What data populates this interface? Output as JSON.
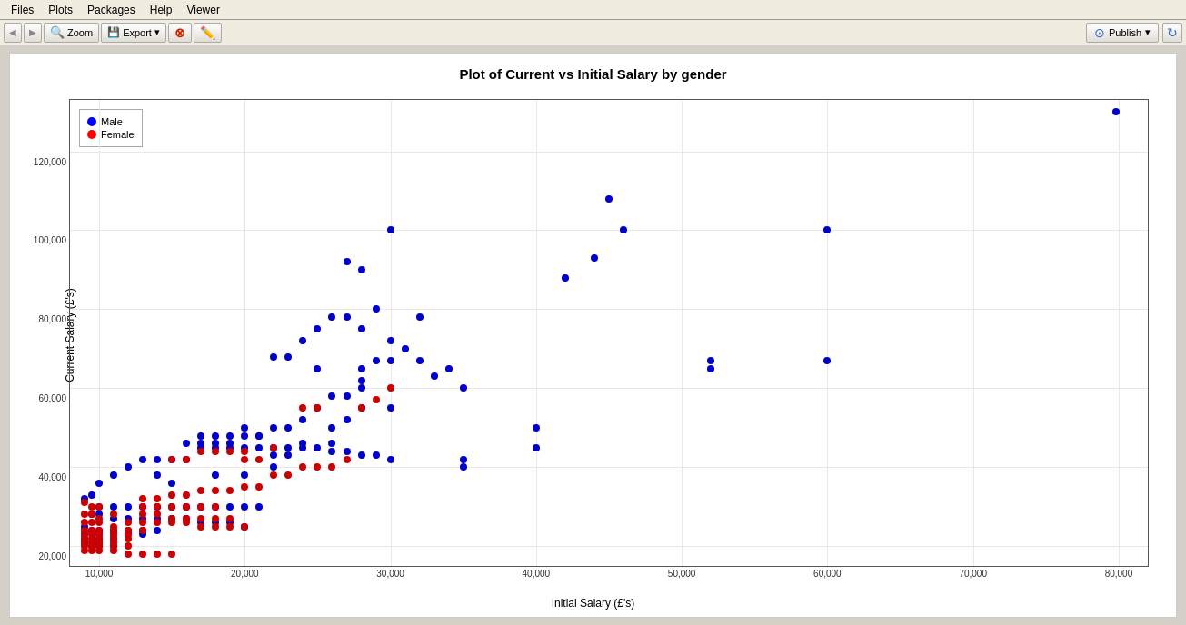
{
  "menubar": {
    "items": [
      "Files",
      "Plots",
      "Packages",
      "Help",
      "Viewer"
    ]
  },
  "toolbar": {
    "back_label": "◀",
    "forward_label": "▶",
    "zoom_label": "Zoom",
    "export_label": "Export",
    "export_arrow": "▾",
    "clear_label": "✕",
    "brush_icon": "✏",
    "publish_label": "Publish",
    "publish_arrow": "▾",
    "refresh_icon": "↻"
  },
  "plot": {
    "title": "Plot of Current vs Initial Salary by gender",
    "x_axis_label": "Initial Salary (£'s)",
    "y_axis_label": "Current Salary (£'s)",
    "x_ticks": [
      "10000",
      "20000",
      "30000",
      "40000",
      "50000",
      "60000",
      "70000",
      "80000"
    ],
    "y_ticks": [
      "20000",
      "40000",
      "60000",
      "80000",
      "100000",
      "120000"
    ],
    "legend": [
      {
        "label": "Male",
        "color": "#0000ff"
      },
      {
        "label": "Female",
        "color": "#ff0000"
      }
    ],
    "blue_dots": [
      [
        79800,
        130000
      ],
      [
        45000,
        108000
      ],
      [
        46000,
        100000
      ],
      [
        42000,
        88000
      ],
      [
        44000,
        93000
      ],
      [
        30000,
        100000
      ],
      [
        27000,
        92000
      ],
      [
        28000,
        90000
      ],
      [
        32000,
        78000
      ],
      [
        29000,
        67000
      ],
      [
        27000,
        78000
      ],
      [
        26000,
        78000
      ],
      [
        28000,
        75000
      ],
      [
        31000,
        70000
      ],
      [
        30000,
        72000
      ],
      [
        29000,
        80000
      ],
      [
        25000,
        75000
      ],
      [
        24000,
        72000
      ],
      [
        23000,
        68000
      ],
      [
        22000,
        68000
      ],
      [
        30000,
        67000
      ],
      [
        32000,
        67000
      ],
      [
        28000,
        65000
      ],
      [
        34000,
        65000
      ],
      [
        33000,
        63000
      ],
      [
        35000,
        60000
      ],
      [
        30000,
        55000
      ],
      [
        28000,
        60000
      ],
      [
        28000,
        55000
      ],
      [
        27000,
        52000
      ],
      [
        26000,
        50000
      ],
      [
        25000,
        55000
      ],
      [
        24000,
        52000
      ],
      [
        23000,
        50000
      ],
      [
        22000,
        50000
      ],
      [
        21000,
        48000
      ],
      [
        20000,
        50000
      ],
      [
        19000,
        48000
      ],
      [
        18000,
        48000
      ],
      [
        17000,
        48000
      ],
      [
        17000,
        45000
      ],
      [
        18000,
        45000
      ],
      [
        19000,
        45000
      ],
      [
        20000,
        45000
      ],
      [
        21000,
        45000
      ],
      [
        22000,
        45000
      ],
      [
        23000,
        45000
      ],
      [
        24000,
        45000
      ],
      [
        25000,
        45000
      ],
      [
        26000,
        44000
      ],
      [
        27000,
        44000
      ],
      [
        28000,
        43000
      ],
      [
        29000,
        43000
      ],
      [
        30000,
        42000
      ],
      [
        35000,
        42000
      ],
      [
        35000,
        40000
      ],
      [
        40000,
        50000
      ],
      [
        40000,
        45000
      ],
      [
        52000,
        67000
      ],
      [
        52000,
        65000
      ],
      [
        60000,
        100000
      ],
      [
        60000,
        67000
      ],
      [
        15000,
        42000
      ],
      [
        16000,
        42000
      ],
      [
        14000,
        42000
      ],
      [
        13000,
        42000
      ],
      [
        12000,
        40000
      ],
      [
        11000,
        38000
      ],
      [
        10000,
        36000
      ],
      [
        9500,
        33000
      ],
      [
        9000,
        32000
      ],
      [
        10000,
        30000
      ],
      [
        11000,
        30000
      ],
      [
        12000,
        30000
      ],
      [
        13000,
        30000
      ],
      [
        14000,
        30000
      ],
      [
        15000,
        30000
      ],
      [
        16000,
        30000
      ],
      [
        17000,
        30000
      ],
      [
        18000,
        30000
      ],
      [
        19000,
        30000
      ],
      [
        20000,
        30000
      ],
      [
        21000,
        30000
      ],
      [
        9500,
        28000
      ],
      [
        10000,
        28000
      ],
      [
        11000,
        27000
      ],
      [
        12000,
        27000
      ],
      [
        13000,
        27000
      ],
      [
        14000,
        27000
      ],
      [
        15000,
        27000
      ],
      [
        16000,
        27000
      ],
      [
        17000,
        26000
      ],
      [
        18000,
        26000
      ],
      [
        19000,
        26000
      ],
      [
        20000,
        25000
      ],
      [
        9000,
        25000
      ],
      [
        9500,
        24000
      ],
      [
        10000,
        24000
      ],
      [
        11000,
        24000
      ],
      [
        12000,
        24000
      ],
      [
        13000,
        24000
      ],
      [
        14000,
        24000
      ],
      [
        9000,
        23000
      ],
      [
        10000,
        23000
      ],
      [
        11000,
        23000
      ],
      [
        12000,
        23000
      ],
      [
        13000,
        23000
      ],
      [
        9000,
        22000
      ],
      [
        10000,
        22000
      ],
      [
        11000,
        22000
      ],
      [
        9000,
        21000
      ],
      [
        10000,
        21000
      ],
      [
        9500,
        20000
      ],
      [
        10000,
        20000
      ],
      [
        11000,
        20000
      ],
      [
        22000,
        43000
      ],
      [
        23000,
        43000
      ],
      [
        25000,
        65000
      ],
      [
        26000,
        58000
      ],
      [
        27000,
        58000
      ],
      [
        28000,
        62000
      ],
      [
        16000,
        46000
      ],
      [
        17000,
        46000
      ],
      [
        18000,
        46000
      ],
      [
        19000,
        46000
      ],
      [
        20000,
        48000
      ],
      [
        21000,
        48000
      ],
      [
        22000,
        40000
      ],
      [
        14000,
        38000
      ],
      [
        15000,
        36000
      ],
      [
        20000,
        38000
      ],
      [
        18000,
        38000
      ],
      [
        26000,
        46000
      ],
      [
        24000,
        46000
      ]
    ],
    "red_dots": [
      [
        9000,
        31000
      ],
      [
        9500,
        30000
      ],
      [
        10000,
        30000
      ],
      [
        9000,
        28000
      ],
      [
        9500,
        28000
      ],
      [
        10000,
        27000
      ],
      [
        11000,
        28000
      ],
      [
        9000,
        26000
      ],
      [
        9500,
        26000
      ],
      [
        10000,
        26000
      ],
      [
        11000,
        25000
      ],
      [
        12000,
        26000
      ],
      [
        9000,
        24000
      ],
      [
        9500,
        24000
      ],
      [
        10000,
        24000
      ],
      [
        11000,
        24000
      ],
      [
        12000,
        24000
      ],
      [
        13000,
        24000
      ],
      [
        9000,
        23000
      ],
      [
        9500,
        23000
      ],
      [
        10000,
        23000
      ],
      [
        11000,
        23000
      ],
      [
        12000,
        23000
      ],
      [
        9000,
        22000
      ],
      [
        9500,
        22000
      ],
      [
        10000,
        22000
      ],
      [
        11000,
        22000
      ],
      [
        12000,
        22000
      ],
      [
        9000,
        21000
      ],
      [
        9500,
        21000
      ],
      [
        10000,
        21000
      ],
      [
        11000,
        21000
      ],
      [
        9000,
        20000
      ],
      [
        9500,
        20000
      ],
      [
        10000,
        20000
      ],
      [
        11000,
        20000
      ],
      [
        12000,
        20000
      ],
      [
        9000,
        19000
      ],
      [
        9500,
        19000
      ],
      [
        10000,
        19000
      ],
      [
        11000,
        19000
      ],
      [
        12000,
        18000
      ],
      [
        13000,
        18000
      ],
      [
        14000,
        18000
      ],
      [
        15000,
        18000
      ],
      [
        13000,
        30000
      ],
      [
        14000,
        30000
      ],
      [
        15000,
        30000
      ],
      [
        16000,
        30000
      ],
      [
        17000,
        30000
      ],
      [
        18000,
        30000
      ],
      [
        13000,
        28000
      ],
      [
        14000,
        28000
      ],
      [
        15000,
        27000
      ],
      [
        16000,
        27000
      ],
      [
        17000,
        27000
      ],
      [
        18000,
        27000
      ],
      [
        19000,
        27000
      ],
      [
        13000,
        26000
      ],
      [
        14000,
        26000
      ],
      [
        15000,
        26000
      ],
      [
        16000,
        26000
      ],
      [
        17000,
        25000
      ],
      [
        18000,
        25000
      ],
      [
        19000,
        25000
      ],
      [
        20000,
        25000
      ],
      [
        13000,
        32000
      ],
      [
        14000,
        32000
      ],
      [
        15000,
        33000
      ],
      [
        16000,
        33000
      ],
      [
        17000,
        34000
      ],
      [
        18000,
        34000
      ],
      [
        19000,
        34000
      ],
      [
        20000,
        35000
      ],
      [
        21000,
        35000
      ],
      [
        22000,
        38000
      ],
      [
        23000,
        38000
      ],
      [
        24000,
        40000
      ],
      [
        25000,
        40000
      ],
      [
        26000,
        40000
      ],
      [
        27000,
        42000
      ],
      [
        28000,
        55000
      ],
      [
        29000,
        57000
      ],
      [
        30000,
        60000
      ],
      [
        20000,
        42000
      ],
      [
        21000,
        42000
      ],
      [
        22000,
        45000
      ],
      [
        15000,
        42000
      ],
      [
        16000,
        42000
      ],
      [
        17000,
        44000
      ],
      [
        18000,
        44000
      ],
      [
        19000,
        44000
      ],
      [
        20000,
        44000
      ],
      [
        24000,
        55000
      ],
      [
        25000,
        55000
      ]
    ]
  }
}
